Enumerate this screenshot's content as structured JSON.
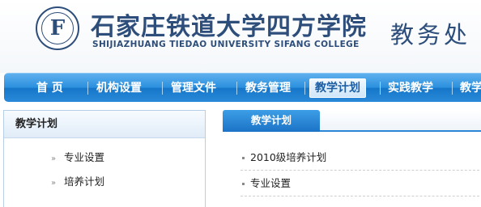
{
  "header": {
    "logo_mark": "F",
    "school_name": "石家庄铁道大学四方学院",
    "school_name_en": "SHIJIAZHUANG TIEDAO UNIVERSITY SIFANG COLLEGE",
    "system_title": "教务处"
  },
  "nav": {
    "items": [
      {
        "label": "首 页"
      },
      {
        "label": "机构设置"
      },
      {
        "label": "管理文件"
      },
      {
        "label": "教务管理"
      },
      {
        "label": "教学计划",
        "active": true
      },
      {
        "label": "实践教学"
      },
      {
        "label": "教学"
      }
    ]
  },
  "left_panel": {
    "title": "教学计划",
    "items": [
      {
        "label": "专业设置"
      },
      {
        "label": "培养计划"
      }
    ]
  },
  "right_panel": {
    "tab_label": "教学计划",
    "items": [
      {
        "label": "2010级培养计划"
      },
      {
        "label": "专业设置"
      }
    ]
  },
  "colors": {
    "brand": "#2d4d7a",
    "nav_blue": "#2a8fdd",
    "active_tab_text": "#1d5ea3"
  }
}
